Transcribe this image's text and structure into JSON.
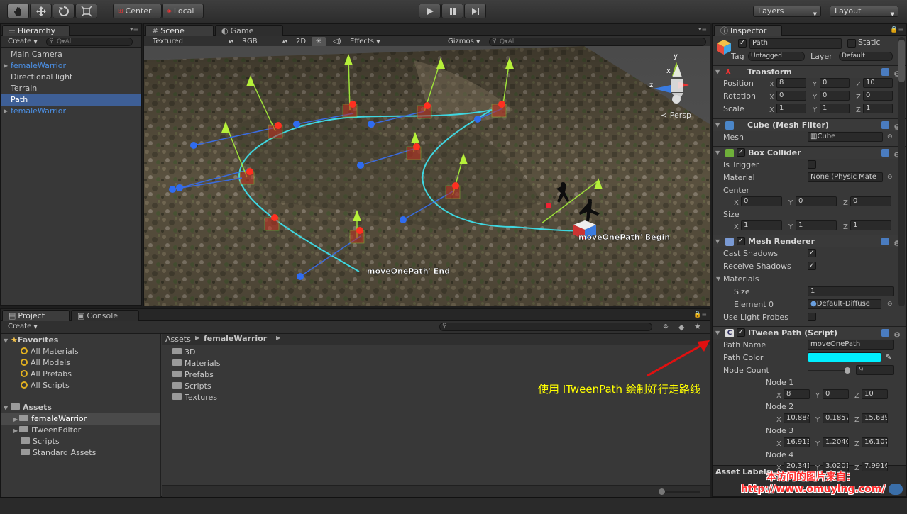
{
  "toolbar": {
    "pivot": "Center",
    "space": "Local",
    "layers": "Layers",
    "layout": "Layout"
  },
  "hierarchy": {
    "tab": "Hierarchy",
    "create": "Create",
    "search_placeholder": "Q▾All",
    "items": [
      {
        "label": "Main Camera"
      },
      {
        "label": "femaleWarrior"
      },
      {
        "label": "Directional light"
      },
      {
        "label": "Terrain"
      },
      {
        "label": "Path"
      },
      {
        "label": "femaleWarrior"
      }
    ]
  },
  "scene": {
    "tabs": [
      "Scene",
      "Game"
    ],
    "shading": "Textured",
    "render_mode": "RGB",
    "mode_2d": "2D",
    "effects": "Effects",
    "gizmos": "Gizmos",
    "search_placeholder": "Q▾All",
    "persp": "Persp",
    "axis_y": "y",
    "axis_x": "x",
    "axis_z": "z",
    "label_begin": "moveOnePath' Begin",
    "label_end": "moveOnePath' End"
  },
  "inspector": {
    "tab": "Inspector",
    "object_name": "Path",
    "static_label": "Static",
    "tag_label": "Tag",
    "tag_value": "Untagged",
    "layer_label": "Layer",
    "layer_value": "Default",
    "transform": {
      "title": "Transform",
      "position_label": "Position",
      "rotation_label": "Rotation",
      "scale_label": "Scale",
      "position": [
        "8",
        "0",
        "10"
      ],
      "rotation": [
        "0",
        "0",
        "0"
      ],
      "scale": [
        "1",
        "1",
        "1"
      ]
    },
    "mesh_filter": {
      "title": "Cube (Mesh Filter)",
      "mesh_label": "Mesh",
      "mesh_value": "Cube"
    },
    "box_collider": {
      "title": "Box Collider",
      "is_trigger": "Is Trigger",
      "material": "Material",
      "material_value": "None (Physic Mate",
      "center": "Center",
      "center_vals": [
        "0",
        "0",
        "0"
      ],
      "size": "Size",
      "size_vals": [
        "1",
        "1",
        "1"
      ]
    },
    "mesh_renderer": {
      "title": "Mesh Renderer",
      "cast_shadows": "Cast Shadows",
      "receive_shadows": "Receive Shadows",
      "materials": "Materials",
      "size_label": "Size",
      "size_value": "1",
      "element0": "Element 0",
      "element0_value": "Default-Diffuse",
      "use_light_probes": "Use Light Probes"
    },
    "itween": {
      "title": "ITween Path (Script)",
      "path_name_label": "Path Name",
      "path_name": "moveOnePath",
      "path_color_label": "Path Color",
      "path_color": "#00f0ff",
      "node_count_label": "Node Count",
      "node_count": "9",
      "node1": "Node 1",
      "node1_vals": [
        "8",
        "0",
        "10"
      ],
      "node2": "Node 2",
      "node2_vals": [
        "10.884",
        "0.1857",
        "15.639"
      ],
      "node3": "Node 3",
      "node3_vals": [
        "16.913",
        "1.2040",
        "16.107"
      ],
      "node4": "Node 4",
      "node4_vals": [
        "20.341",
        "3.0201",
        "7.9916"
      ]
    },
    "asset_labels": "Asset Labels"
  },
  "project": {
    "tabs": [
      "Project",
      "Console"
    ],
    "create": "Create",
    "favorites": "Favorites",
    "fav_items": [
      "All Materials",
      "All Models",
      "All Prefabs",
      "All Scripts"
    ],
    "assets": "Assets",
    "asset_tree": [
      "femaleWarrior",
      "iTweenEditor",
      "Scripts",
      "Standard Assets"
    ],
    "breadcrumb_root": "Assets",
    "breadcrumb_leaf": "femaleWarrior",
    "folders": [
      "3D",
      "Materials",
      "Prefabs",
      "Scripts",
      "Textures"
    ]
  },
  "annotation": {
    "text": "使用 ITweenPath 绘制好行走路线",
    "color": "#ffff00",
    "arrow_color": "#e01010"
  },
  "watermark": {
    "line1": "本访问的图片来自：",
    "line2": "http://www.omuying.com/"
  }
}
